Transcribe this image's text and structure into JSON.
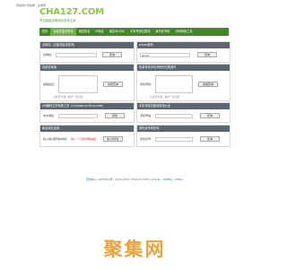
{
  "top": {
    "links": "登陆用户添加网 - 注册网"
  },
  "logo": {
    "main": "CHA127.COM",
    "sub": "专业智能全网综合查询主网"
  },
  "nav": {
    "items": [
      "首页",
      "百度关键词查询",
      "网站排名",
      "IP地址",
      "域名WHOIS",
      "手机号码归属地",
      "身份证号码",
      "代码转换工具"
    ]
  },
  "panels": {
    "baidu": {
      "title": "全网站（百度关键词查询）",
      "label": "全网站：",
      "button": "查询"
    },
    "whois": {
      "title": "whois查询",
      "input_value": "whois",
      "button": "查询"
    },
    "pr": {
      "title": "批量查询网",
      "label": "批量站点：",
      "button": "批量查询",
      "note": "以逗号分割，每行一条记录"
    },
    "mobile_batch": {
      "title": "批量查询手机号码的归属城市",
      "label": "手机号码：",
      "button": "批量查询",
      "note": "以逗号分割，每行一条记录"
    },
    "unicode": {
      "title": "GB编码汉字转换工具（Unicode to Punycode）",
      "label": "中文域名：",
      "button": "转换"
    },
    "mobile": {
      "title": "手机号码归属地查询大全",
      "label": "手机号码：",
      "button": "查询"
    },
    "ip": {
      "title": "网站域名查询",
      "label": "输入域名/服务器IP地址：",
      "hint": "输入一个完整的网站地址",
      "button": "输入框查询"
    },
    "idcard": {
      "title": "身份证号码查询",
      "label": "身份证号：",
      "button": "查询"
    }
  },
  "footer": {
    "prefix": "查询中心",
    "icp": "1250531号",
    "copyright": "| 2010-2021 CHA127.COM |",
    "links": "ac9ote - 4RMKL | 3dfxol"
  },
  "watermark": "聚集网"
}
